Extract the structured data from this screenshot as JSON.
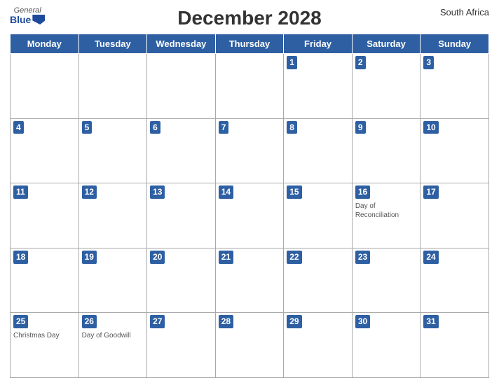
{
  "header": {
    "title": "December 2028",
    "country": "South Africa",
    "logo_general": "General",
    "logo_blue": "Blue"
  },
  "days_of_week": [
    "Monday",
    "Tuesday",
    "Wednesday",
    "Thursday",
    "Friday",
    "Saturday",
    "Sunday"
  ],
  "weeks": [
    [
      {
        "day": "",
        "holiday": ""
      },
      {
        "day": "",
        "holiday": ""
      },
      {
        "day": "",
        "holiday": ""
      },
      {
        "day": "",
        "holiday": ""
      },
      {
        "day": "1",
        "holiday": ""
      },
      {
        "day": "2",
        "holiday": ""
      },
      {
        "day": "3",
        "holiday": ""
      }
    ],
    [
      {
        "day": "4",
        "holiday": ""
      },
      {
        "day": "5",
        "holiday": ""
      },
      {
        "day": "6",
        "holiday": ""
      },
      {
        "day": "7",
        "holiday": ""
      },
      {
        "day": "8",
        "holiday": ""
      },
      {
        "day": "9",
        "holiday": ""
      },
      {
        "day": "10",
        "holiday": ""
      }
    ],
    [
      {
        "day": "11",
        "holiday": ""
      },
      {
        "day": "12",
        "holiday": ""
      },
      {
        "day": "13",
        "holiday": ""
      },
      {
        "day": "14",
        "holiday": ""
      },
      {
        "day": "15",
        "holiday": ""
      },
      {
        "day": "16",
        "holiday": "Day of Reconciliation"
      },
      {
        "day": "17",
        "holiday": ""
      }
    ],
    [
      {
        "day": "18",
        "holiday": ""
      },
      {
        "day": "19",
        "holiday": ""
      },
      {
        "day": "20",
        "holiday": ""
      },
      {
        "day": "21",
        "holiday": ""
      },
      {
        "day": "22",
        "holiday": ""
      },
      {
        "day": "23",
        "holiday": ""
      },
      {
        "day": "24",
        "holiday": ""
      }
    ],
    [
      {
        "day": "25",
        "holiday": "Christmas Day"
      },
      {
        "day": "26",
        "holiday": "Day of Goodwill"
      },
      {
        "day": "27",
        "holiday": ""
      },
      {
        "day": "28",
        "holiday": ""
      },
      {
        "day": "29",
        "holiday": ""
      },
      {
        "day": "30",
        "holiday": ""
      },
      {
        "day": "31",
        "holiday": ""
      }
    ]
  ]
}
